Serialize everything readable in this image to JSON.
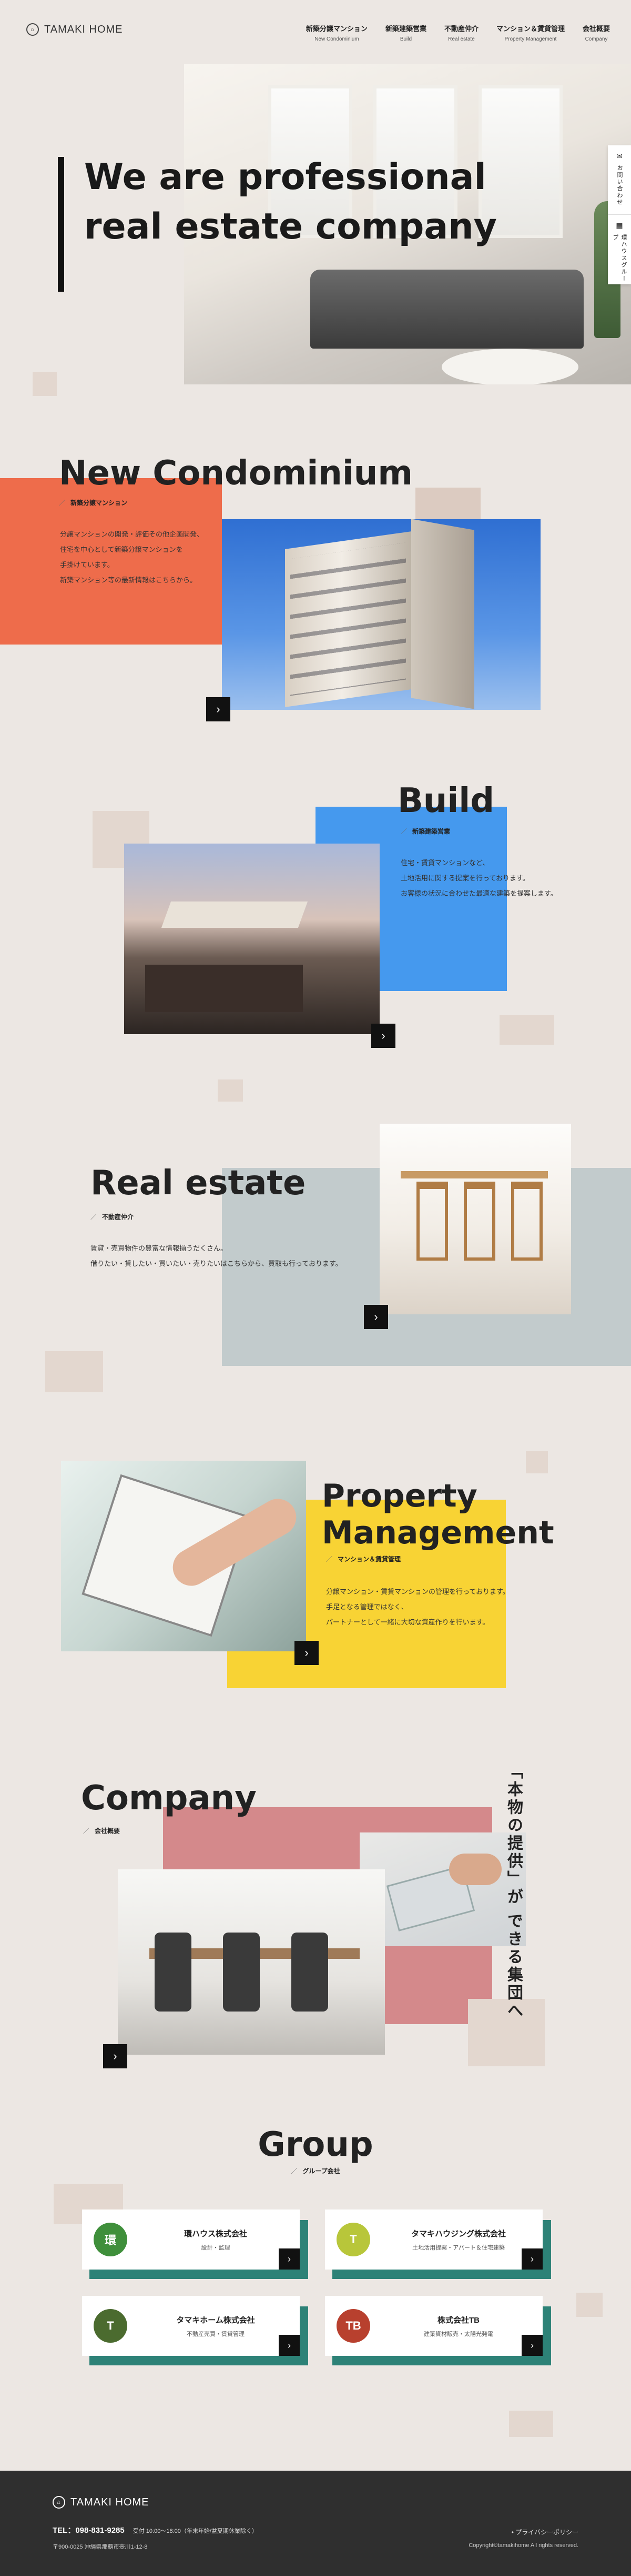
{
  "header": {
    "brand": "TAMAKI HOME",
    "logo_glyph": "⌂",
    "nav": [
      {
        "ja": "新築分譲マンション",
        "en": "New Condominium"
      },
      {
        "ja": "新築建築営業",
        "en": "Build"
      },
      {
        "ja": "不動産仲介",
        "en": "Real estate"
      },
      {
        "ja": "マンション＆賃貸管理",
        "en": "Property Management"
      },
      {
        "ja": "会社概要",
        "en": "Company"
      }
    ]
  },
  "side_tabs": [
    {
      "icon": "mail-icon",
      "label": "お問い合わせ"
    },
    {
      "icon": "building-icon",
      "label": "環ハウスグループ"
    }
  ],
  "hero": {
    "catch": "We are professional real estate company"
  },
  "sections": {
    "condo": {
      "title": "New Condominium",
      "sub": "新築分譲マンション",
      "body": [
        "分譲マンションの開発・評価その他企画開発、",
        "住宅を中心として新築分譲マンションを",
        "手掛けています。",
        "新築マンション等の最新情報はこちらから。"
      ]
    },
    "build": {
      "title": "Build",
      "sub": "新築建築営業",
      "body": [
        "住宅・賃貸マンションなど、",
        "土地活用に関する提案を行っております。",
        "お客様の状況に合わせた最適な建築を提案します。"
      ]
    },
    "real_estate": {
      "title": "Real estate",
      "sub": "不動産仲介",
      "body": [
        "賃貸・売買物件の豊富な情報揃うだくさん。",
        "借りたい・貸したい・買いたい・売りたいはこちらから、買取も行っております。"
      ]
    },
    "property": {
      "title_line1": "Property",
      "title_line2": "Management",
      "sub": "マンション＆賃貸管理",
      "body": [
        "分譲マンション・賃貸マンションの管理を行っております。",
        "手足となる管理ではなく、",
        "パートナーとして一緒に大切な資産作りを行います。"
      ]
    },
    "company": {
      "title": "Company",
      "sub": "会社概要",
      "catch_line1": "「本物の提供」が",
      "catch_line2": "できる集団へ"
    },
    "group": {
      "title": "Group",
      "sub": "グループ会社",
      "cards": [
        {
          "name": "環ハウス株式会社",
          "desc": "設計・監理",
          "mark": "環",
          "color": "#3f8f3b"
        },
        {
          "name": "タマキハウジング株式会社",
          "desc": "土地活用提案・アパート＆住宅建築",
          "mark": "T",
          "color": "#b8c63a"
        },
        {
          "name": "タマキホーム株式会社",
          "desc": "不動産売買・賃貸管理",
          "mark": "T",
          "color": "#4b6b2f"
        },
        {
          "name": "株式会社TB",
          "desc": "建築資材販売・太陽光発電",
          "mark": "TB",
          "color": "#b8402e"
        }
      ]
    }
  },
  "arrow_glyph": "›",
  "footer": {
    "brand": "TAMAKI HOME",
    "tel": "TEL：098-831-9285",
    "hours": "受付 10:00～18:00（年末年始/盆夏期休業除く）",
    "address": "〒900-0025 沖縄県那覇市壺川1-12-8",
    "privacy": "• プライバシーポリシー",
    "copyright": "Copyright©tamakihome All rights reserved."
  },
  "colors": {
    "bg": "#ece7e3",
    "condo_block": "#ee6c4b",
    "build_block": "#4599ee",
    "real_estate_block": "#c2cbcc",
    "property_block": "#f8d334",
    "company_block": "#d4898b",
    "group_shadow": "#2d8277",
    "footer": "#2f2f2f"
  }
}
